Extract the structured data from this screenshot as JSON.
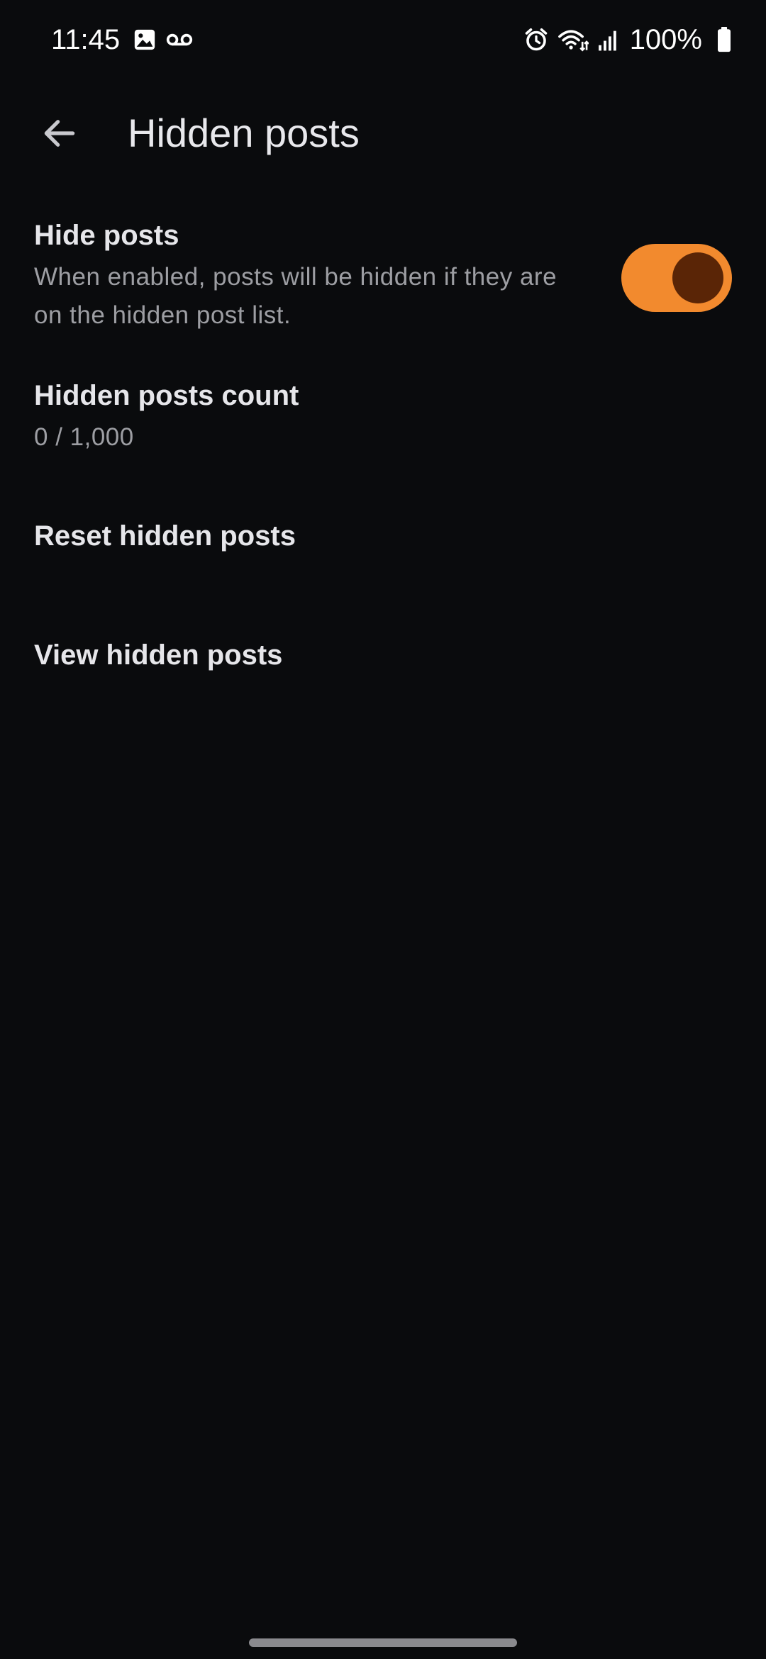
{
  "status_bar": {
    "time": "11:45",
    "battery": "100%",
    "icons": [
      "image-icon",
      "voicemail-icon",
      "alarm-icon",
      "wifi-icon",
      "signal-icon",
      "battery-icon"
    ]
  },
  "app_bar": {
    "title": "Hidden posts",
    "back_icon": "arrow-back-icon"
  },
  "settings": {
    "hide_posts": {
      "title": "Hide posts",
      "summary": "When enabled, posts will be hidden if they are on the hidden post list.",
      "enabled": true
    },
    "hidden_count": {
      "title": "Hidden posts count",
      "value": "0 / 1,000"
    },
    "reset": {
      "title": "Reset hidden posts"
    },
    "view": {
      "title": "View hidden posts"
    }
  },
  "colors": {
    "background": "#0a0b0d",
    "accent": "#f28a2e",
    "switch_thumb": "#5a2506",
    "text_primary": "#e6e6ea",
    "text_secondary": "#9d9ea3"
  }
}
